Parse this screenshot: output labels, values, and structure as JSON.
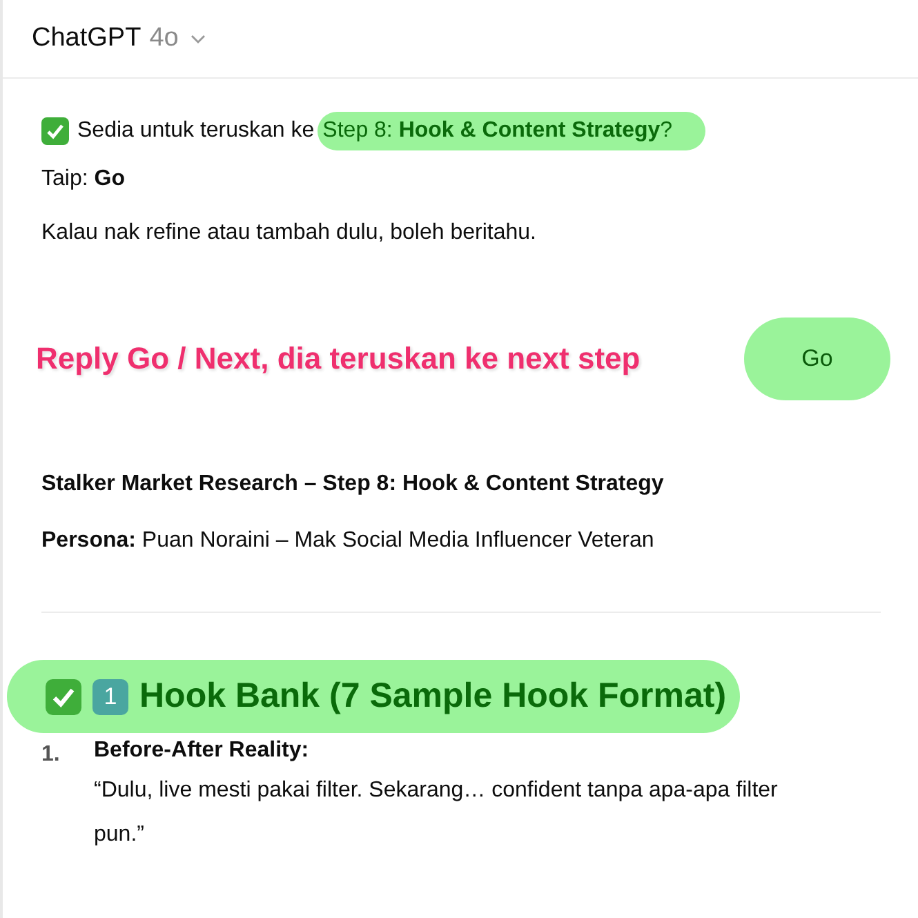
{
  "header": {
    "title": "ChatGPT",
    "model": "4o"
  },
  "prompt": {
    "lead": "Sedia untuk teruskan ke",
    "highlight": "Step 8: **Hook & Content Strategy**?",
    "highlighted": true
  },
  "type_hint": "Taip: **Go**",
  "note": "Kalau nak refine atau tambah dulu, boleh beritahu.",
  "annotation": "Reply Go / Next, dia teruskan ke next step",
  "reply_button": {
    "label": "Go",
    "highlighted": true
  },
  "title": "Stalker Market Research – Step 8: Hook & Content Strategy",
  "persona": "**Persona:** Puan Noraini – Mak Social Media Influencer Veteran",
  "section": {
    "keycap": "1",
    "title": "Hook Bank (7 Sample Hook Format)",
    "highlighted": true
  },
  "items": [
    {
      "number": "1.",
      "label": "Before-After Reality:",
      "quote": "“Dulu, live mesti pakai filter. Sekarang… confident tanpa apa-apa filter pun.”"
    }
  ]
}
